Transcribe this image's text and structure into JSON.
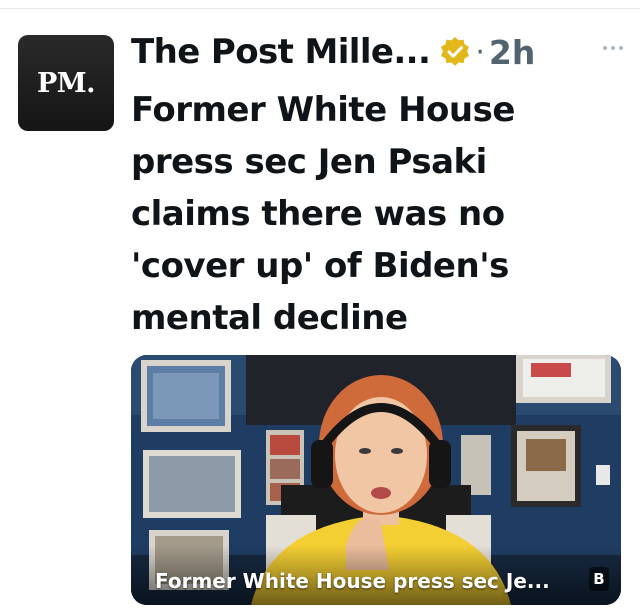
{
  "post": {
    "author": {
      "name": "The Post Mille...",
      "avatar_text": "PM.",
      "verified_icon": "verified-badge-icon",
      "verified_color": "#e2b719"
    },
    "separator": "·",
    "timestamp": "2h",
    "more_icon": "more-horizontal-icon",
    "text": "Former White House press sec Jen Psaki claims there was no 'cover up' of Biden's mental decline",
    "media": {
      "caption": "Former White House press sec Je...",
      "badge_icon": "gif-badge-icon"
    }
  }
}
